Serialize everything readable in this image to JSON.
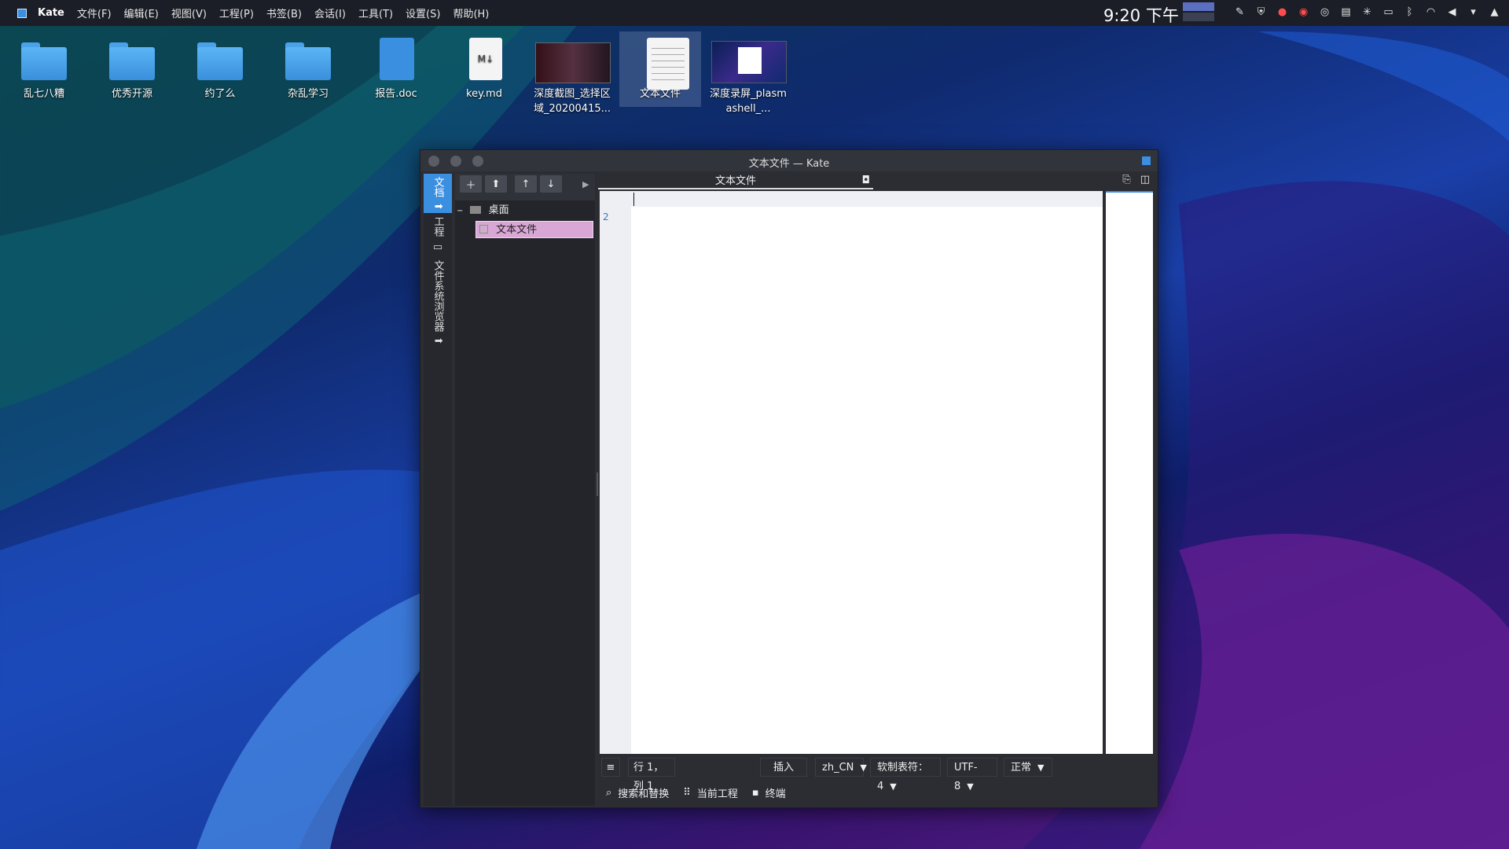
{
  "topbar": {
    "app_name": "Kate",
    "menu": [
      "文件(F)",
      "编辑(E)",
      "视图(V)",
      "工程(P)",
      "书签(B)",
      "会话(I)",
      "工具(T)",
      "设置(S)",
      "帮助(H)"
    ],
    "clock": "9:20 下午",
    "tray_icons": [
      "notes-icon",
      "shield-icon",
      "record-icon",
      "ubuntu-icon",
      "chrome-icon",
      "clipboard-icon",
      "network-icon",
      "battery-icon",
      "bluetooth-icon",
      "wifi-icon",
      "volume-icon",
      "expand-icon",
      "kde-icon"
    ]
  },
  "desktop": {
    "icons": [
      {
        "label": "乱七八糟",
        "kind": "folder"
      },
      {
        "label": "优秀开源",
        "kind": "folder"
      },
      {
        "label": "约了么",
        "kind": "folder"
      },
      {
        "label": "杂乱学习",
        "kind": "folder"
      },
      {
        "label": "报告.doc",
        "kind": "doc"
      },
      {
        "label": "key.md",
        "kind": "md"
      },
      {
        "label": "深度截图_选择区域_20200415...",
        "kind": "shot"
      },
      {
        "label": "文本文件",
        "kind": "txt"
      },
      {
        "label": "深度录屏_plasmashell_...",
        "kind": "rec"
      }
    ]
  },
  "kate": {
    "title": "文本文件 — Kate",
    "side_tabs": {
      "documents": "文档",
      "projects": "工程",
      "filesystem": "文件系统浏览器"
    },
    "tree": {
      "folder": "桌面",
      "file": "文本文件"
    },
    "doc_tab": "文本文件",
    "line_numbers": [
      "2"
    ],
    "status": {
      "position": "行 1，列 1",
      "mode": "插入",
      "language": "zh_CN",
      "tabs": "软制表符：4",
      "encoding": "UTF-8",
      "syntax": "正常"
    },
    "toolviews": {
      "search": "搜索和替换",
      "project": "当前工程",
      "terminal": "终端"
    }
  }
}
